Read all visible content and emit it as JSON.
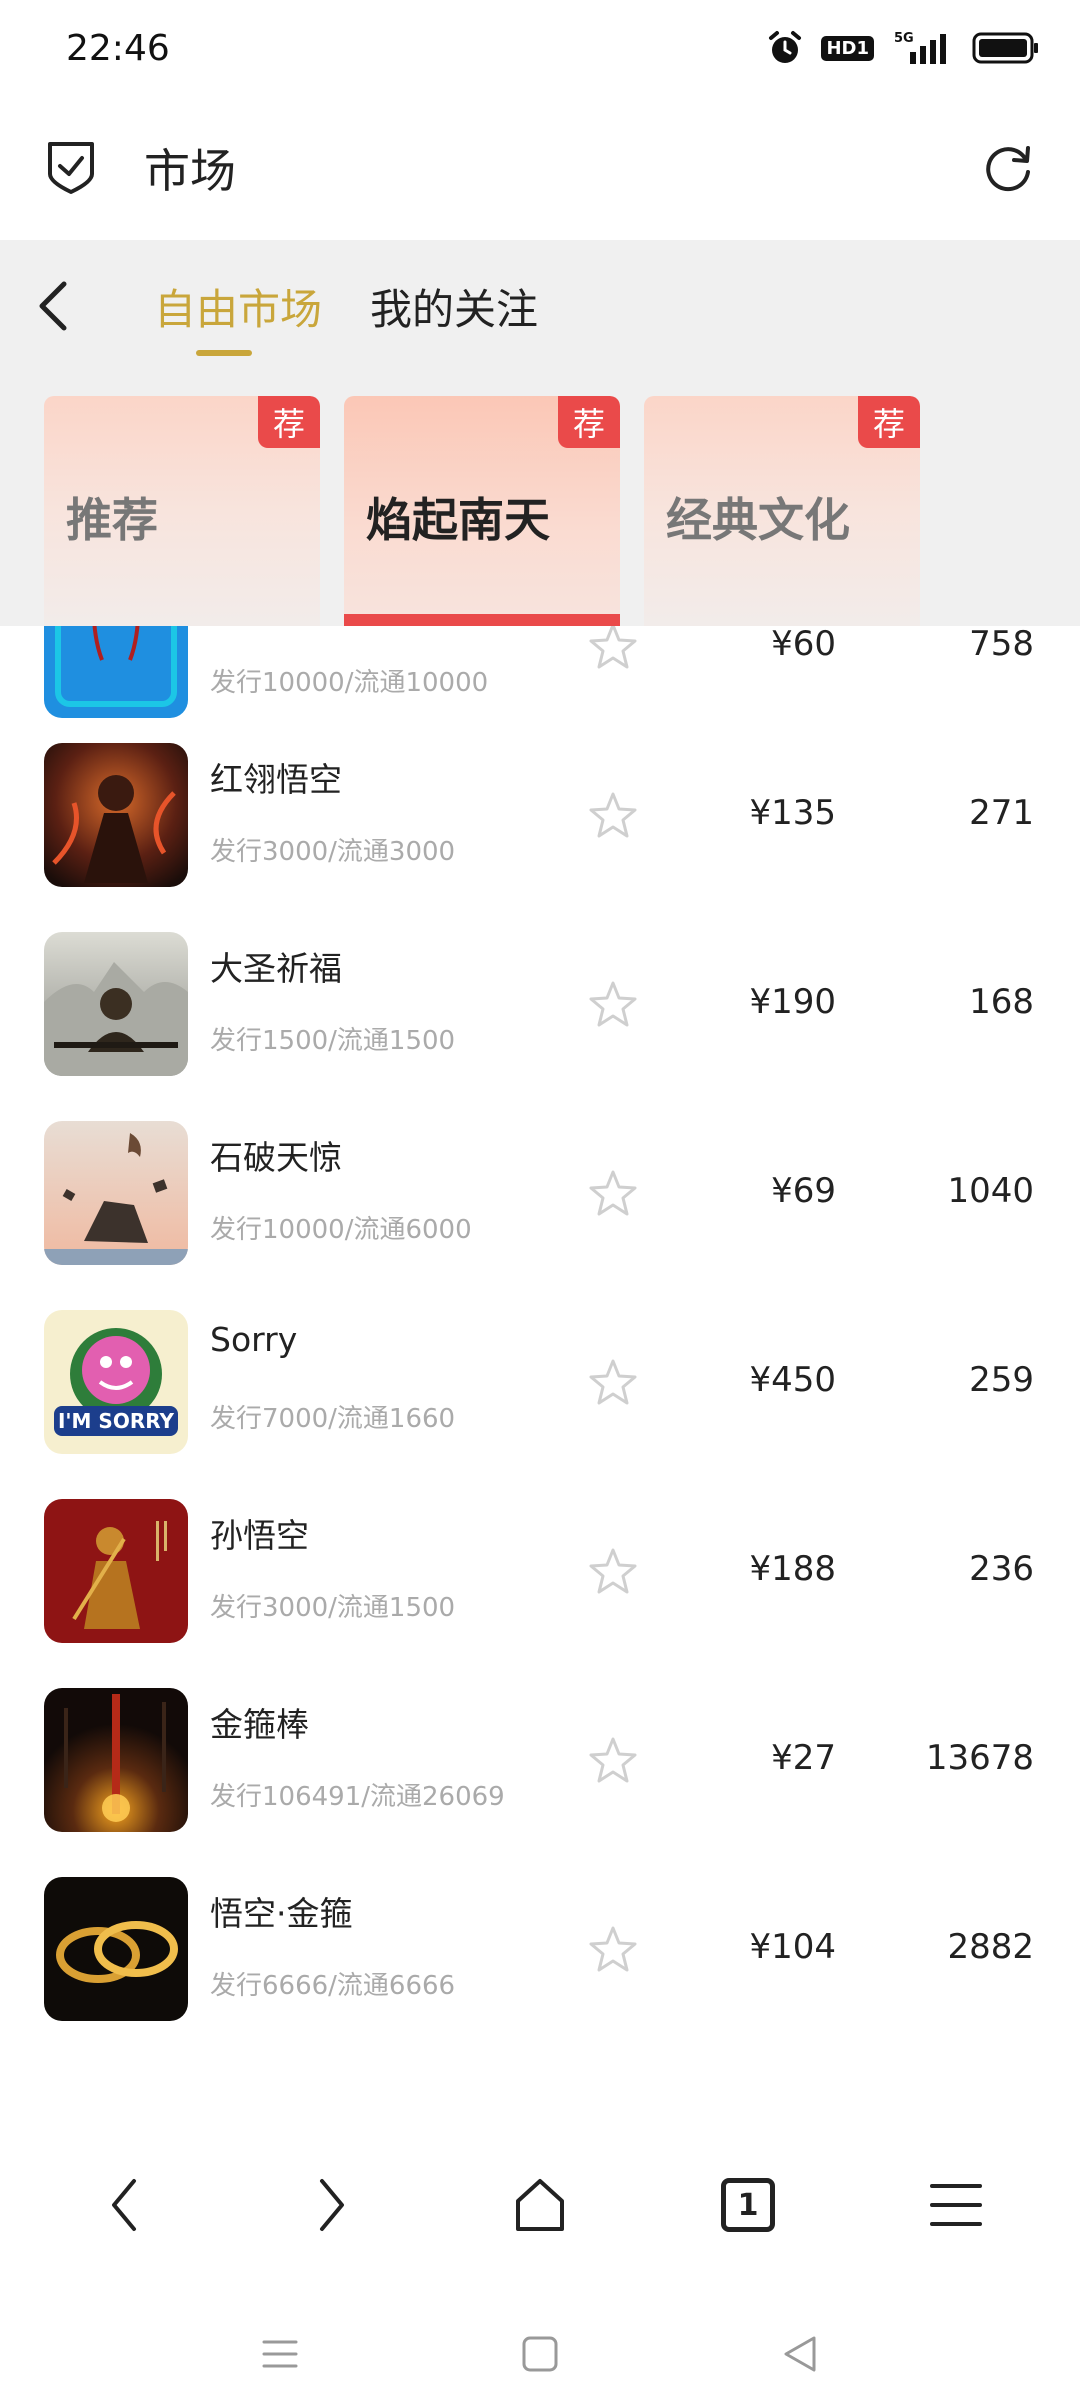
{
  "status_bar": {
    "time": "22:46",
    "network": "5G",
    "hd": "HD1"
  },
  "header": {
    "title": "市场"
  },
  "market_tabs": [
    {
      "label": "自由市场",
      "active": true
    },
    {
      "label": "我的关注",
      "active": false
    }
  ],
  "categories": [
    {
      "label": "推荐",
      "badge": "荐",
      "active": false
    },
    {
      "label": "焰起南天",
      "badge": "荐",
      "active": true
    },
    {
      "label": "经典文化",
      "badge": "荐",
      "active": false
    }
  ],
  "items": [
    {
      "name": "",
      "issue": "发行10000/流通10000",
      "price": "¥60",
      "count": "758",
      "thumb": "blue-frame"
    },
    {
      "name": "红翎悟空",
      "issue": "发行3000/流通3000",
      "price": "¥135",
      "count": "271",
      "thumb": "fire-warrior"
    },
    {
      "name": "大圣祈福",
      "issue": "发行1500/流通1500",
      "price": "¥190",
      "count": "168",
      "thumb": "meditating-monkey"
    },
    {
      "name": "石破天惊",
      "issue": "发行10000/流通6000",
      "price": "¥69",
      "count": "1040",
      "thumb": "rock-burst"
    },
    {
      "name": "Sorry",
      "issue": "发行7000/流通1660",
      "price": "¥450",
      "count": "259",
      "thumb": "im-sorry-logo"
    },
    {
      "name": "孙悟空",
      "issue": "发行3000/流通1500",
      "price": "¥188",
      "count": "236",
      "thumb": "red-monkey-king"
    },
    {
      "name": "金箍棒",
      "issue": "发行106491/流通26069",
      "price": "¥27",
      "count": "13678",
      "thumb": "golden-staff"
    },
    {
      "name": "悟空·金箍",
      "issue": "发行6666/流通6666",
      "price": "¥104",
      "count": "2882",
      "thumb": "golden-rings"
    }
  ],
  "browser_bar": {
    "tab_count": "1"
  },
  "colors": {
    "accent_gold": "#c9a63b",
    "badge_red": "#ea4a4a",
    "panel_gray": "#f0f0f0",
    "muted_text": "#aaaaaa"
  }
}
